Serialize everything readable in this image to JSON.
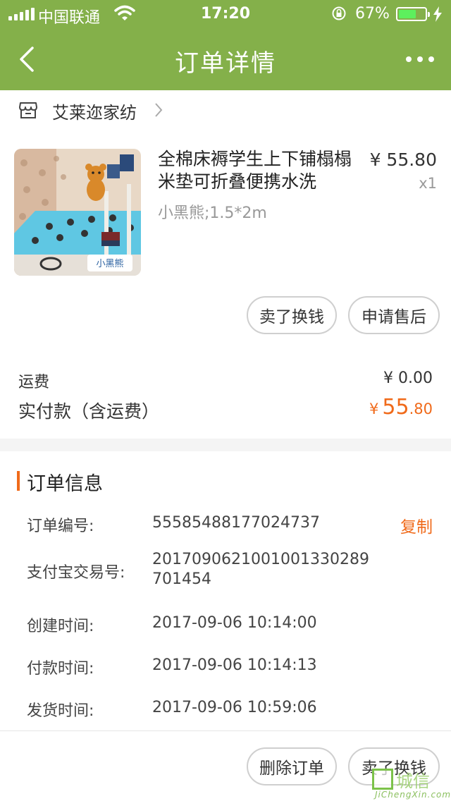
{
  "status_bar": {
    "carrier": "中国联通",
    "time": "17:20",
    "battery_percent": "67%",
    "battery_level": 0.67
  },
  "nav": {
    "title": "订单详情"
  },
  "store": {
    "name": "艾莱迩家纺"
  },
  "product": {
    "title": "全棉床褥学生上下铺榻榻米垫可折叠便携水洗",
    "sku": "小黑熊;1.5*2m",
    "price": "¥ 55.80",
    "quantity": "x1",
    "image_caption": "小黑熊"
  },
  "product_actions": {
    "sell": "卖了换钱",
    "after_sale": "申请售后"
  },
  "summary": {
    "shipping_label": "运费",
    "shipping_value": "¥ 0.00",
    "paid_label": "实付款（含运费）",
    "paid_symbol": "¥",
    "paid_int": "55",
    "paid_dec": ".80"
  },
  "order_info": {
    "title": "订单信息",
    "copy_label": "复制",
    "rows": [
      {
        "label": "订单编号:",
        "value": "55585488177024737"
      },
      {
        "label": "支付宝交易号:",
        "value": "2017090621001001330289701454"
      },
      {
        "label": "创建时间:",
        "value": "2017-09-06 10:14:00"
      },
      {
        "label": "付款时间:",
        "value": "2017-09-06 10:14:13"
      },
      {
        "label": "发货时间:",
        "value": "2017-09-06 10:59:06"
      }
    ]
  },
  "bottom_actions": {
    "delete": "删除订单",
    "sell": "卖了换钱"
  },
  "watermark": {
    "text": "城信",
    "sub": "JiChengXin.com"
  },
  "colors": {
    "header": "#84b04a",
    "accent": "#f06a1a"
  },
  "icons": [
    "signal-icon",
    "wifi-icon",
    "lock-rotation-icon",
    "battery-icon",
    "charging-bolt-icon",
    "back-arrow-icon",
    "more-dots-icon",
    "store-icon",
    "chevron-right-icon"
  ]
}
